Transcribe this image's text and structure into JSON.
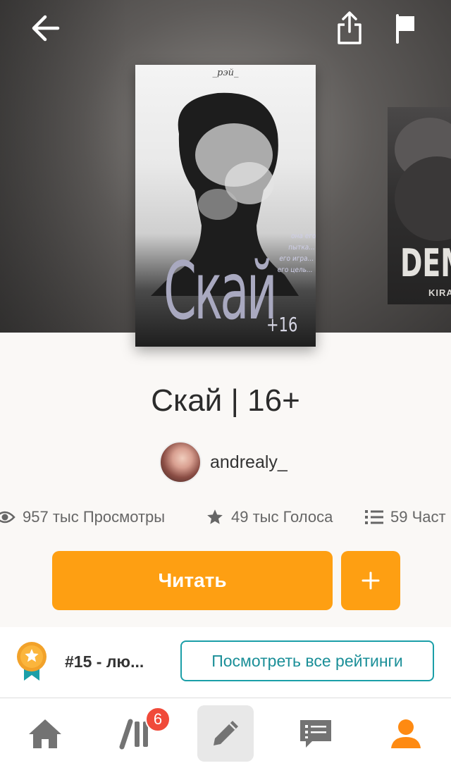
{
  "header": {
    "back_icon": "arrow-left-icon",
    "share_icon": "share-icon",
    "report_icon": "flag-icon"
  },
  "cover": {
    "author_mark": "_рэй_",
    "tagline": [
      "она его пытка...",
      "его игра...",
      "его цель..."
    ],
    "title": "Скай",
    "age": "+16"
  },
  "next_cover": {
    "title": "DEM",
    "subtitle": "KIRA"
  },
  "story": {
    "title": "Скай | 16+",
    "author": "andrealy_"
  },
  "stats": {
    "views": "957 тыс Просмотры",
    "votes": "49 тыс Голоса",
    "parts": "59 Част"
  },
  "actions": {
    "read_label": "Читать",
    "add_label": "+"
  },
  "ranking": {
    "text": "#15 - лю...",
    "button_label": "Посмотреть все рейтинги"
  },
  "nav": {
    "library_badge": "6",
    "items": [
      "home",
      "library",
      "write",
      "messages",
      "profile"
    ]
  },
  "colors": {
    "accent": "#fe9f12",
    "teal": "#1b9fa8",
    "badge": "#f04a3a"
  }
}
